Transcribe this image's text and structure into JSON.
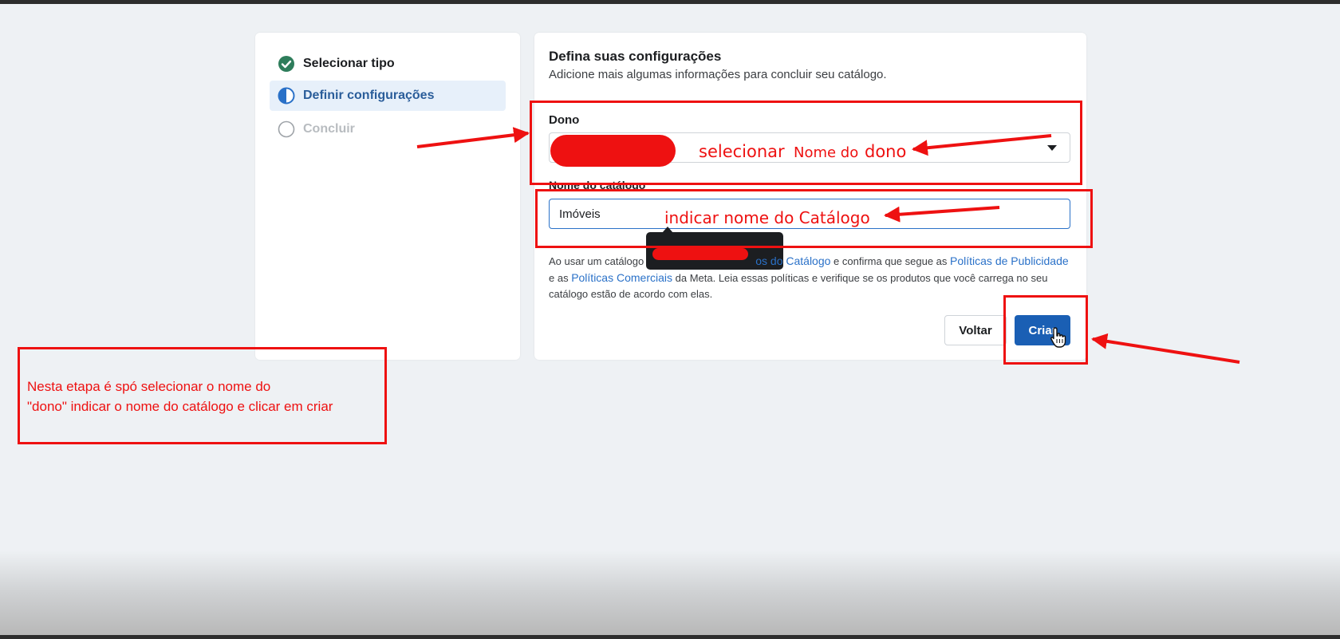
{
  "steps": {
    "items": [
      {
        "label": "Selecionar tipo",
        "state": "complete"
      },
      {
        "label": "Definir configurações",
        "state": "current"
      },
      {
        "label": "Concluir",
        "state": "pending"
      }
    ]
  },
  "form": {
    "title": "Defina suas configurações",
    "subtitle": "Adicione mais algumas informações para concluir seu catálogo.",
    "owner_label": "Dono",
    "catalog_label": "Nome do catálogo",
    "catalog_value": "Imóveis",
    "legal": {
      "part1": "Ao usar um catálogo",
      "link1": "os do Catálogo",
      "part2": " e confirma que segue as ",
      "link2": "Políticas de Publicidade",
      "part3": " e as ",
      "link3": "Políticas Comerciais",
      "part4": " da Meta. Leia essas políticas e verifique se os produtos que você carrega no seu catálogo estão de acordo com elas."
    },
    "back_label": "Voltar",
    "create_label": "Criar"
  },
  "annotations": {
    "owner_hint_1": "selecionar",
    "owner_hint_2": "Nome do",
    "owner_hint_3": "dono",
    "catalog_hint": "indicar nome do Catálogo",
    "note_line_1": "Nesta etapa é spó selecionar o nome do",
    "note_line_2": "\"dono\" indicar o nome do catálogo e clicar em criar"
  },
  "colors": {
    "annotation_red": "#ee1111",
    "primary_blue": "#1a5fb4",
    "link_blue": "#2a71c8",
    "complete_green": "#2e7d5b"
  }
}
